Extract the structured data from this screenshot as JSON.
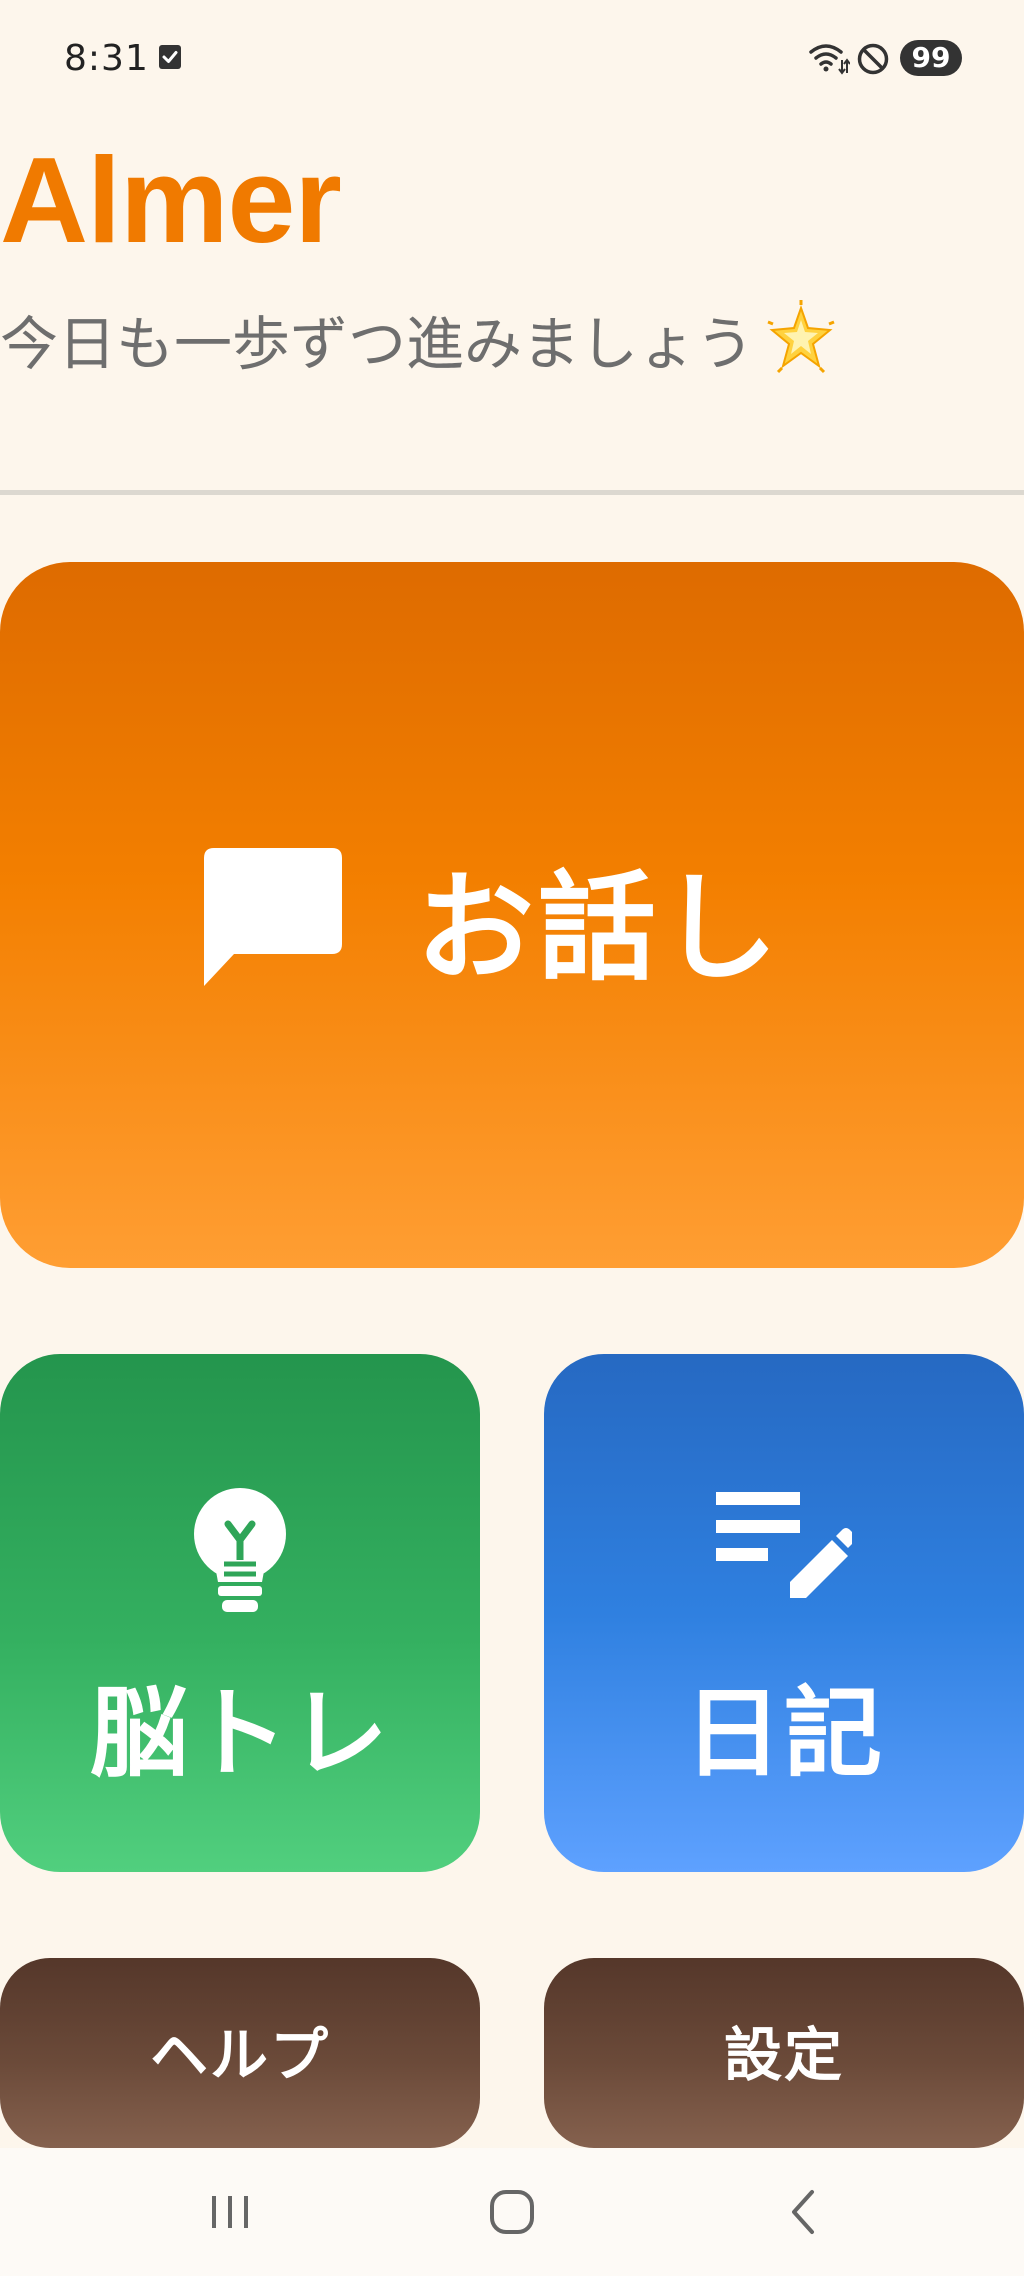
{
  "status_bar": {
    "time": "8:31",
    "battery": "99",
    "icons": [
      "checkbox-icon",
      "wifi-icon",
      "do-not-disturb-icon",
      "battery-icon"
    ]
  },
  "header": {
    "title": "Almer",
    "subtitle": "今日も一歩ずつ進みましょう",
    "subtitle_icon": "sparkle-star-icon"
  },
  "tiles": {
    "talk": {
      "label": "お話し",
      "icon": "chat-bubble-icon"
    },
    "brain": {
      "label": "脳トレ",
      "icon": "lightbulb-icon"
    },
    "diary": {
      "label": "日記",
      "icon": "edit-note-icon"
    },
    "help": {
      "label": "ヘルプ"
    },
    "settings": {
      "label": "設定"
    }
  },
  "colors": {
    "title": "#F07A00",
    "talk": "#F37F00",
    "brain": "#34B060",
    "diary": "#2F80E0",
    "small_buttons": "#6B4A39",
    "background": "#FDF6EC"
  },
  "nav_bar": {
    "icons": [
      "recent-apps-icon",
      "home-icon",
      "back-icon"
    ]
  }
}
